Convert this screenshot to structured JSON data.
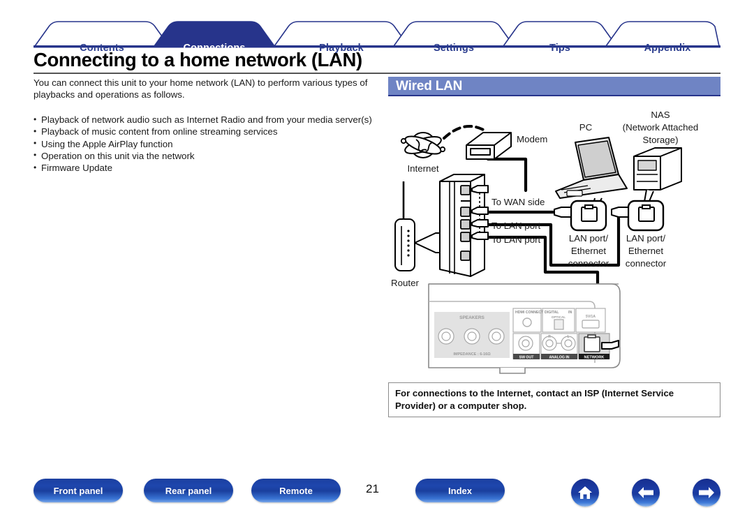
{
  "tabs": [
    {
      "label": "Contents",
      "active": false
    },
    {
      "label": "Connections",
      "active": true
    },
    {
      "label": "Playback",
      "active": false
    },
    {
      "label": "Settings",
      "active": false
    },
    {
      "label": "Tips",
      "active": false
    },
    {
      "label": "Appendix",
      "active": false
    }
  ],
  "title": "Connecting to a home network (LAN)",
  "lead": "You can connect this unit to your home network (LAN) to perform various types of playbacks and operations as follows.",
  "bullets": [
    "Playback of network audio such as Internet Radio and from your media server(s)",
    "Playback of music content from online streaming services",
    "Using the Apple AirPlay function",
    "Operation on this unit via the network",
    "Firmware Update"
  ],
  "section": {
    "title": "Wired LAN"
  },
  "diagram": {
    "internet": "Internet",
    "modem": "Modem",
    "router": "Router",
    "pc": "PC",
    "nas_line1": "NAS",
    "nas_line2": "(Network Attached",
    "nas_line3": "Storage)",
    "to_wan": "To WAN side",
    "to_lan_1": "To LAN port",
    "to_lan_2": "To LAN port",
    "pc_port_l1": "LAN port/",
    "pc_port_l2": "Ethernet",
    "pc_port_l3": "connector",
    "nas_port_l1": "LAN port/",
    "nas_port_l2": "Ethernet",
    "nas_port_l3": "connector",
    "rear_panel": {
      "speakers": "SPEAKERS",
      "impedance": "IMPEDANCE : 6-16Ω",
      "hdmi_connect": "HDMI CONNECT",
      "digital": "DIGITAL",
      "in": "IN",
      "optical": "OPTICAL",
      "usb": "5V/1A",
      "sw_out": "SW OUT",
      "analog_in": "ANALOG IN",
      "network": "NETWORK",
      "ch_r": "R",
      "ch_l": "L"
    }
  },
  "note": "For connections to the Internet, contact an ISP (Internet Service Provider) or a computer shop.",
  "footer": {
    "front_panel": "Front panel",
    "rear_panel": "Rear panel",
    "remote": "Remote",
    "page_number": "21",
    "index": "Index",
    "home_icon": "home-icon",
    "back_icon": "arrow-left-icon",
    "forward_icon": "arrow-right-icon"
  },
  "colors": {
    "tab_active_bg": "#27348b",
    "tab_text": "#2a3c8e",
    "section_bar": "#6f84c4",
    "button_blue": "#1b3fa0"
  }
}
